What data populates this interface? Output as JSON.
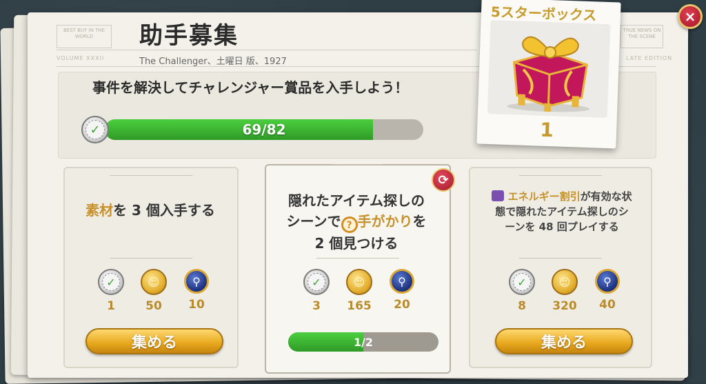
{
  "header": {
    "title": "助手募集",
    "subtitle": "The Challenger、土曜日 版、1927",
    "mast_left_box": "BEST BUY IN THE WORLD",
    "mast_left_small": "VOLUME XXXII",
    "mast_right_box": "TRUE NEWS ON THE SCENE",
    "mast_right_small": "LATE EDITION"
  },
  "main_quest": {
    "text": "事件を解決してチャレンジャー賞品を入手しよう！",
    "progress_text": "69/82",
    "progress_fraction": 0.8415
  },
  "reward_box": {
    "title": "5スターボックス",
    "count": "1",
    "icon": "gift-box-icon"
  },
  "close_icon": "×",
  "tasks": [
    {
      "text_highlight": "素材",
      "text_rest": "を 3 個入手する",
      "rewards": [
        {
          "icon": "check-badge-icon",
          "value": "1"
        },
        {
          "icon": "coin-icon",
          "value": "50"
        },
        {
          "icon": "magnifier-badge-icon",
          "value": "10"
        }
      ],
      "button_label": "集める"
    },
    {
      "text_before": "隠れたアイテム探しのシーンで",
      "text_highlight": "手がかり",
      "text_after": "を 2 個見つける",
      "rewards": [
        {
          "icon": "check-badge-icon",
          "value": "3"
        },
        {
          "icon": "coin-icon",
          "value": "165"
        },
        {
          "icon": "magnifier-badge-icon",
          "value": "20"
        }
      ],
      "progress_text": "1/2",
      "progress_fraction": 0.5,
      "refresh_icon": "refresh-icon"
    },
    {
      "text_highlight": "エネルギー割引",
      "text_rest": "が有効な状態で隠れたアイテム探しのシーンを 48 回プレイする",
      "rewards": [
        {
          "icon": "check-badge-icon",
          "value": "8"
        },
        {
          "icon": "coin-icon",
          "value": "320"
        },
        {
          "icon": "magnifier-badge-icon",
          "value": "40"
        }
      ],
      "button_label": "集める"
    }
  ],
  "colors": {
    "accent_gold": "#c7912a",
    "progress_green": "#3fb435",
    "background": "#2f3e45"
  }
}
